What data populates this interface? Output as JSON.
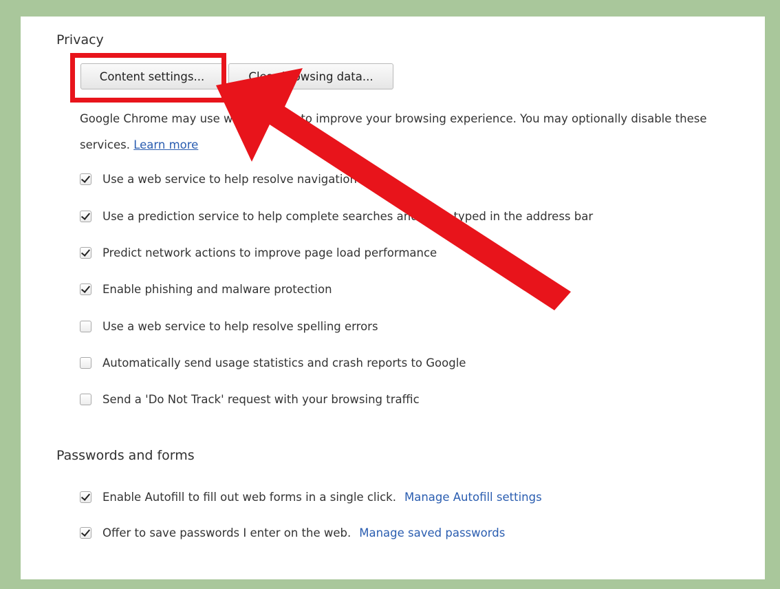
{
  "privacy": {
    "title": "Privacy",
    "content_settings_label": "Content settings...",
    "clear_browsing_label": "Clear browsing data...",
    "description_line1": "Google Chrome may use web services to improve your browsing experience. You may optionally disable these",
    "description_line2": "services.",
    "learn_more": "Learn more",
    "options": [
      {
        "label": "Use a web service to help resolve navigation errors",
        "checked": true
      },
      {
        "label": "Use a prediction service to help complete searches and URLs typed in the address bar",
        "checked": true
      },
      {
        "label": "Predict network actions to improve page load performance",
        "checked": true
      },
      {
        "label": "Enable phishing and malware protection",
        "checked": true
      },
      {
        "label": "Use a web service to help resolve spelling errors",
        "checked": false
      },
      {
        "label": "Automatically send usage statistics and crash reports to Google",
        "checked": false
      },
      {
        "label": "Send a 'Do Not Track' request with your browsing traffic",
        "checked": false
      }
    ]
  },
  "passwords": {
    "title": "Passwords and forms",
    "options": [
      {
        "label": "Enable Autofill to fill out web forms in a single click.",
        "link": "Manage Autofill settings",
        "checked": true
      },
      {
        "label": "Offer to save passwords I enter on the web.",
        "link": "Manage saved passwords",
        "checked": true
      }
    ]
  },
  "colors": {
    "background": "#a9c79b",
    "annotation": "#e8141b",
    "link": "#2a5db0"
  }
}
